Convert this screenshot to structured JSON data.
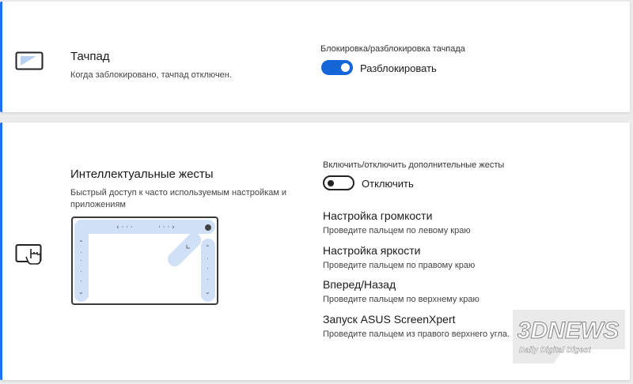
{
  "touchpad": {
    "title": "Тачпад",
    "description": "Когда заблокировано, тачпад отключен.",
    "setting_label": "Блокировка/разблокировка тачпада",
    "toggle_state": "on",
    "toggle_text": "Разблокировать"
  },
  "gestures": {
    "title": "Интеллектуальные жесты",
    "description_line1": "Быстрый доступ к часто используемым настройкам и",
    "description_line2": "приложениям",
    "setting_label": "Включить/отключить дополнительные жесты",
    "toggle_state": "off",
    "toggle_text": "Отключить",
    "items": [
      {
        "title": "Настройка громкости",
        "desc": "Проведите пальцем по левому краю"
      },
      {
        "title": "Настройка яркости",
        "desc": "Проведите пальцем по правому краю"
      },
      {
        "title": "Вперед/Назад",
        "desc": "Проведите пальцем по верхнему краю"
      },
      {
        "title": "Запуск ASUS ScreenXpert",
        "desc": "Проведите пальцем из правого верхнего угла."
      }
    ]
  },
  "watermark": {
    "logo": "3DNEWS",
    "tagline": "Daily Digital Digest"
  },
  "colors": {
    "accent": "#1565d8",
    "card_border": "#1a73e8",
    "highlight": "#cfe0f7"
  }
}
